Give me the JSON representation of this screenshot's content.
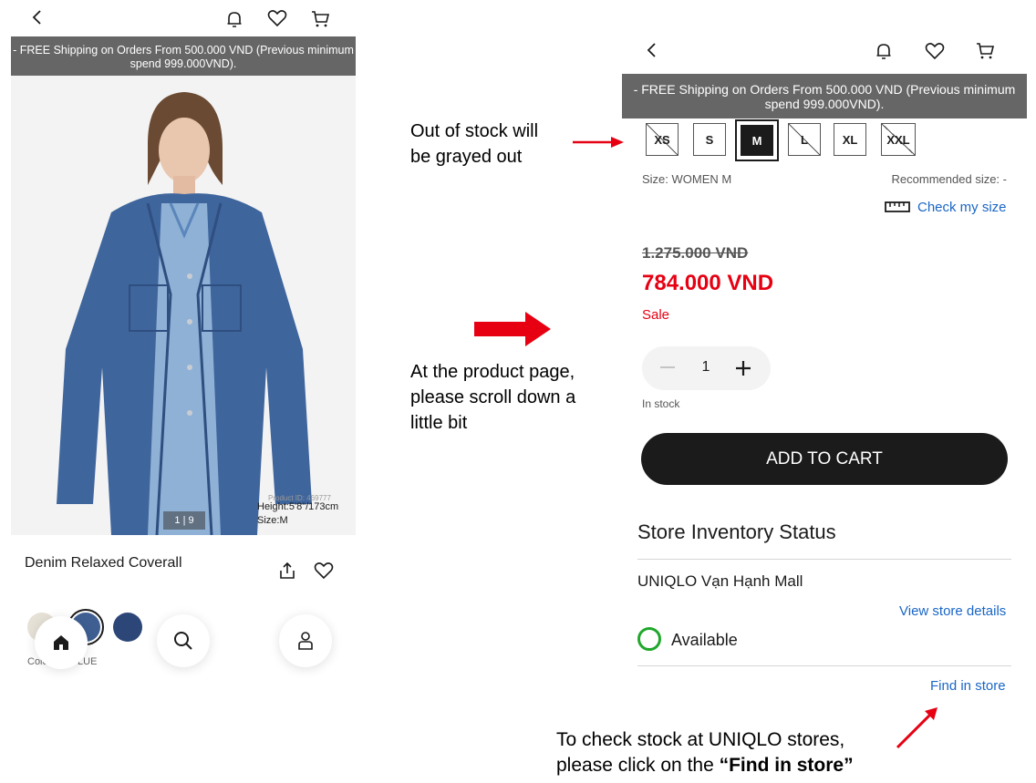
{
  "left_phone": {
    "banner": "- FREE Shipping on Orders From 500.000 VND (Previous minimum spend 999.000VND).",
    "image_overlay": {
      "product_id": "Product ID: 469777",
      "height": "Height:5'8\"/173cm",
      "size": "Size:M",
      "pagination": "1 | 9"
    },
    "product_name": "Denim Relaxed Coverall",
    "color_label": "Color: 65 BLUE",
    "swatch_colors": [
      "#e6e1d6",
      "#3f5f93",
      "#2c4677"
    ]
  },
  "right_phone": {
    "banner": "- FREE Shipping on Orders From 500.000 VND (Previous minimum spend 999.000VND).",
    "sizes": [
      {
        "label": "XS",
        "state": "out-of-stock"
      },
      {
        "label": "S",
        "state": "available"
      },
      {
        "label": "M",
        "state": "selected"
      },
      {
        "label": "L",
        "state": "out-of-stock"
      },
      {
        "label": "XL",
        "state": "available"
      },
      {
        "label": "XXL",
        "state": "out-of-stock"
      }
    ],
    "size_text": "Size: WOMEN M",
    "recommended_size": "Recommended size: -",
    "check_size": "Check my size",
    "original_price": "1.275.000 VND",
    "sale_price": "784.000 VND",
    "sale_label": "Sale",
    "quantity": "1",
    "stock_status": "In stock",
    "add_to_cart": "ADD TO CART",
    "inventory_title": "Store Inventory Status",
    "store_name": "UNIQLO Vạn Hạnh Mall",
    "view_store_details": "View store details",
    "availability": "Available",
    "find_in_store": "Find in store"
  },
  "annotations": {
    "out_of_stock_l1": "Out of stock will",
    "out_of_stock_l2": "be grayed out",
    "scroll_l1": "At the product page,",
    "scroll_l2": "please scroll down a",
    "scroll_l3": "little bit",
    "find_l1": "To check stock at UNIQLO stores,",
    "find_l2_prefix": "please click on the ",
    "find_l2_bold": "“Find in store”"
  },
  "colors": {
    "accent_red": "#e60012",
    "link_blue": "#1a66c6",
    "available_green": "#1fa82b",
    "banner_gray": "#666666"
  }
}
